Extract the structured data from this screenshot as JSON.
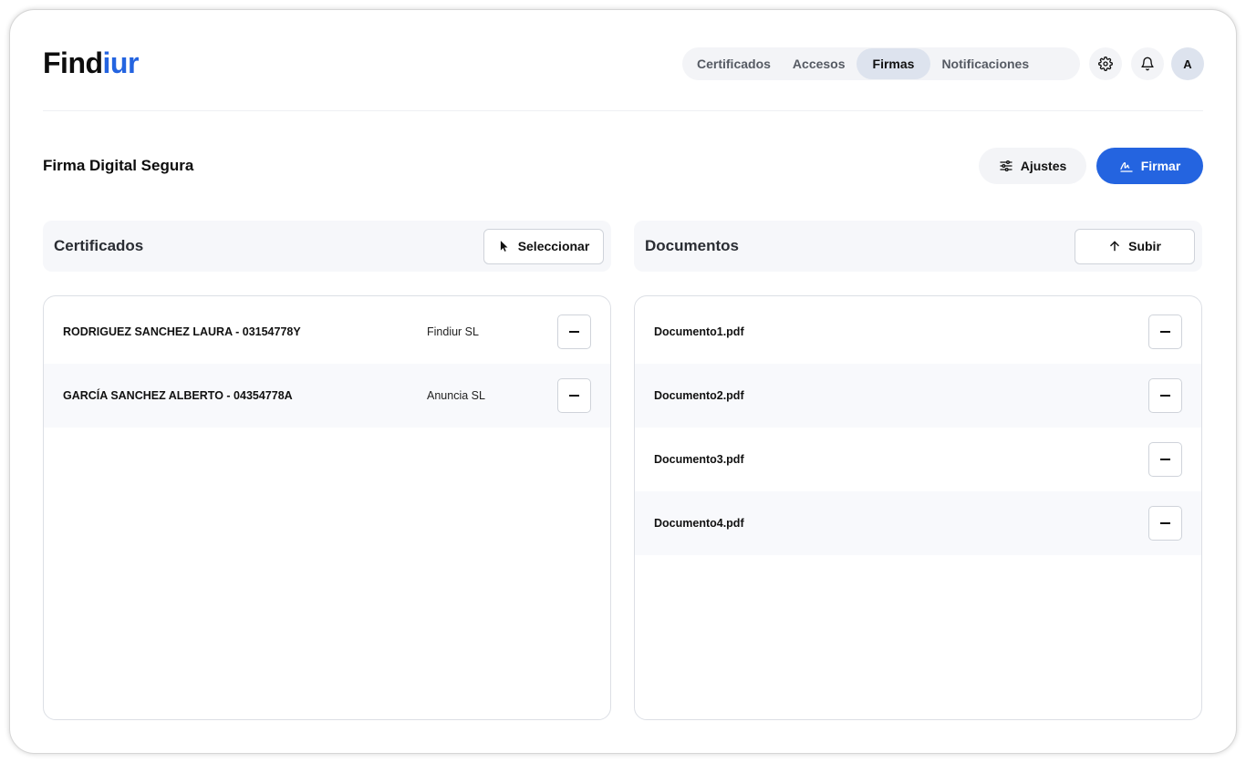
{
  "brand": {
    "name_part1": "Find",
    "name_part2": "iur",
    "accent_color": "#2464e0"
  },
  "nav": {
    "tabs": [
      {
        "label": "Certificados",
        "active": false
      },
      {
        "label": "Accesos",
        "active": false
      },
      {
        "label": "Firmas",
        "active": true
      },
      {
        "label": "Notificaciones",
        "active": false
      }
    ],
    "icons": [
      "gear-icon",
      "bell-icon"
    ],
    "avatar_initial": "A"
  },
  "page": {
    "title": "Firma Digital Segura",
    "settings_label": "Ajustes",
    "sign_label": "Firmar"
  },
  "certificates": {
    "title": "Certificados",
    "action_label": "Seleccionar",
    "items": [
      {
        "name": "RODRIGUEZ SANCHEZ LAURA - 03154778Y",
        "company": "Findiur SL"
      },
      {
        "name": "GARCÍA SANCHEZ ALBERTO - 04354778A",
        "company": "Anuncia SL"
      }
    ]
  },
  "documents": {
    "title": "Documentos",
    "action_label": "Subir",
    "items": [
      {
        "name": "Documento1.pdf"
      },
      {
        "name": "Documento2.pdf"
      },
      {
        "name": "Documento3.pdf"
      },
      {
        "name": "Documento4.pdf"
      }
    ]
  }
}
